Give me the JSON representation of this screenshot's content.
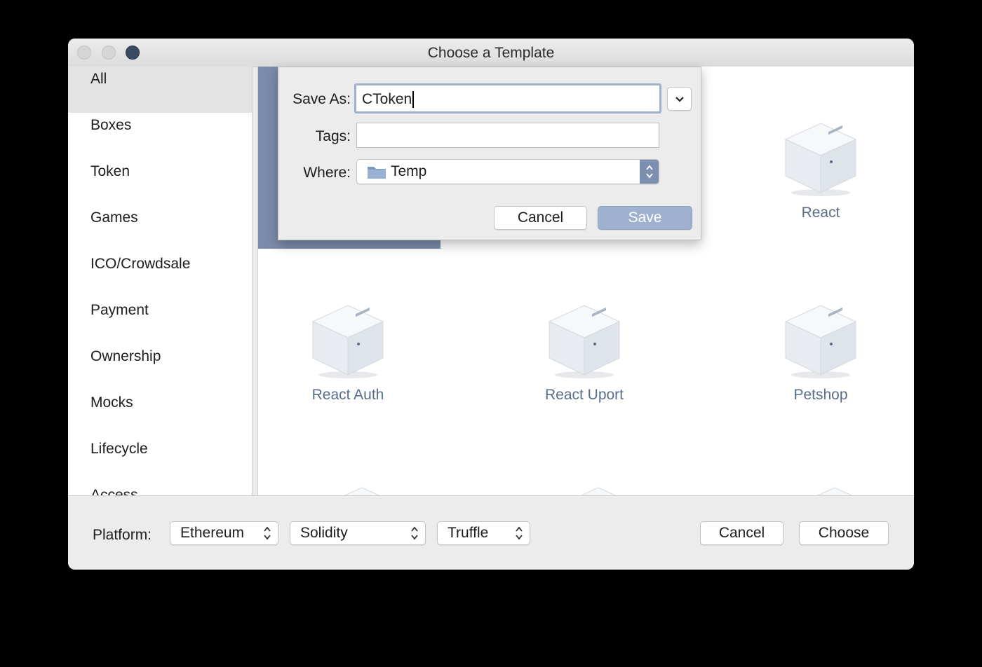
{
  "window": {
    "title": "Choose a Template"
  },
  "sidebar": {
    "items": [
      {
        "label": "All",
        "selected": true
      },
      {
        "label": "Boxes"
      },
      {
        "label": "Token"
      },
      {
        "label": "Games"
      },
      {
        "label": "ICO/Crowdsale"
      },
      {
        "label": "Payment"
      },
      {
        "label": "Ownership"
      },
      {
        "label": "Mocks"
      },
      {
        "label": "Lifecycle"
      },
      {
        "label": "Access"
      }
    ]
  },
  "templates": [
    {
      "label": "React",
      "icon": "box-icon"
    },
    {
      "label": "React Auth",
      "icon": "box-icon"
    },
    {
      "label": "React Uport",
      "icon": "box-icon"
    },
    {
      "label": "Petshop",
      "icon": "box-icon"
    }
  ],
  "save_sheet": {
    "save_as_label": "Save As:",
    "save_as_value": "CToken",
    "tags_label": "Tags:",
    "tags_value": "",
    "where_label": "Where:",
    "where_value": "Temp",
    "cancel_label": "Cancel",
    "save_label": "Save"
  },
  "bottom": {
    "platform_label": "Platform:",
    "platform_value": "Ethereum",
    "language_value": "Solidity",
    "framework_value": "Truffle",
    "cancel_label": "Cancel",
    "choose_label": "Choose"
  },
  "colors": {
    "selection": "#7b8cab",
    "save_button": "#9eb2cf",
    "label_text": "#5a6d88"
  }
}
